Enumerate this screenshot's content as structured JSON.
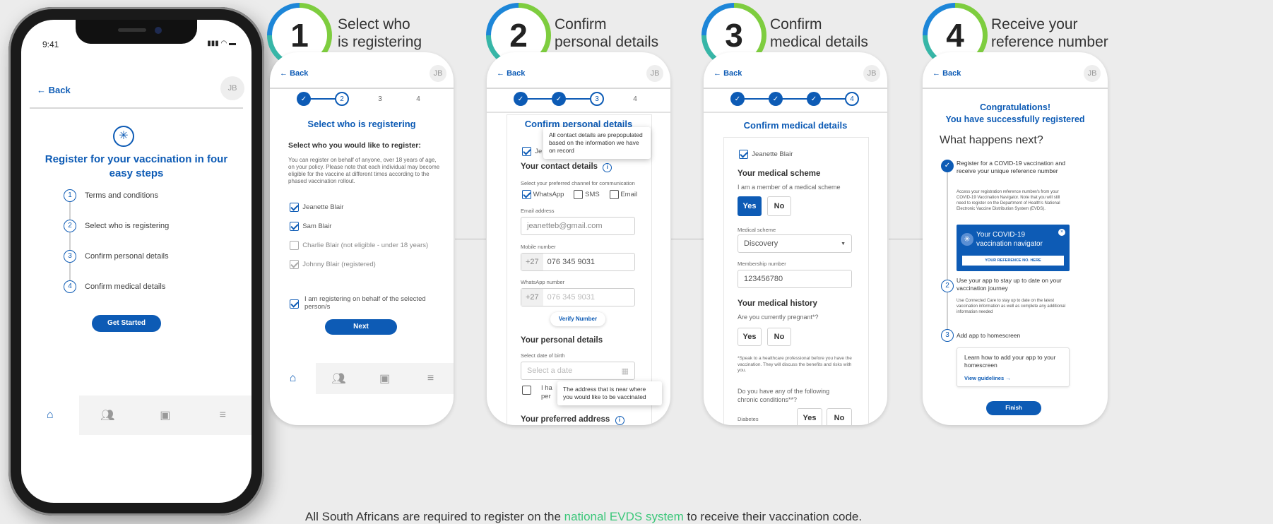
{
  "phone": {
    "time": "9:41",
    "back": "Back",
    "avatar": "JB",
    "title": "Register for your vaccination in four easy steps",
    "steps": [
      {
        "num": "1",
        "label": "Terms and conditions"
      },
      {
        "num": "2",
        "label": "Select who is registering"
      },
      {
        "num": "3",
        "label": "Confirm personal details"
      },
      {
        "num": "4",
        "label": "Confirm medical details"
      }
    ],
    "button": "Get Started"
  },
  "badges": [
    {
      "num": "1",
      "caption": [
        "Select who",
        "is registering"
      ]
    },
    {
      "num": "2",
      "caption": [
        "Confirm",
        "personal details"
      ]
    },
    {
      "num": "3",
      "caption": [
        "Confirm",
        "medical details"
      ]
    },
    {
      "num": "4",
      "caption": [
        "Receive your",
        "reference number"
      ]
    }
  ],
  "common": {
    "back": "Back",
    "avatar": "JB",
    "progress": [
      "1",
      "2",
      "3",
      "4"
    ]
  },
  "card1": {
    "title": "Select who is registering",
    "subtitle": "Select who you would like to register:",
    "intro": "You can register on behalf of anyone, over 18 years of age, on your policy. Please note that each individual may become eligible for the vaccine at different times according to the phased vaccination rollout.",
    "people": [
      "Jeanette Blair",
      "Sam Blair",
      "Charlie Blair (not eligible - under 18 years)",
      "Johnny Blair (registered)"
    ],
    "consent": "I am registering on behalf of the selected person/s",
    "button": "Next"
  },
  "card2": {
    "title": "Confirm personal details",
    "tooltip1": "All contact details are prepopulated based on the information we have on record",
    "name_partial": "Je",
    "contact_heading": "Your contact details",
    "channel_hint": "Select your preferred channel for communication",
    "channels": [
      "WhatsApp",
      "SMS",
      "Email"
    ],
    "email_label": "Email address",
    "email_value": "jeanetteb@gmail.com",
    "mobile_label": "Mobile number",
    "prefix": "+27",
    "mobile_value": "076 345 9031",
    "whatsapp_label": "WhatsApp number",
    "whatsapp_value": "076 345 9031",
    "verify": "Verify Number",
    "personal_heading": "Your personal details",
    "dob_label": "Select date of birth",
    "dob_placeholder": "Select a date",
    "partial_text1": "I ha",
    "partial_text2": "per",
    "tooltip2": "The address that is near where you would like to be vaccinated",
    "address_heading": "Your preferred address"
  },
  "card3": {
    "title": "Confirm medical details",
    "name": "Jeanette Blair",
    "scheme_heading": "Your medical scheme",
    "scheme_q": "I am a member of a medical scheme",
    "yes": "Yes",
    "no": "No",
    "scheme_label": "Medical scheme",
    "scheme_value": "Discovery",
    "membership_label": "Membership number",
    "membership_value": "123456780",
    "history_heading": "Your medical history",
    "pregnant_q": "Are you currently pregnant*?",
    "footnote": "*Speak to a healthcare professional before you have the vaccination. They will discuss the benefits and risks with you.",
    "chronic_q": "Do you have any of the following chronic conditions**?",
    "diabetes": "Diabetes"
  },
  "card4": {
    "congrats1": "Congratulations!",
    "congrats2": "You have successfully registered",
    "next": "What happens next?",
    "s1_title": "Register for a COVID-19 vaccination and receive your unique reference number",
    "s1_text": "Access your registration reference number/s from your COVID-19 Vaccination Navigator. Note that you will still need to register on the Department of Health's National Electronic Vaccine Distribution System (EVDS).",
    "nav_title": "Your COVID-19 vaccination navigator",
    "nav_ref": "YOUR REFERENCE NO. HERE",
    "s2_num": "2",
    "s2_title": "Use your app to stay up to date on your vaccination journey",
    "s2_text": "Use Connected Care to stay up to date on the latest vaccination information as well as complete any additional information needed",
    "s3_num": "3",
    "s3_title": "Add app to homescreen",
    "learn": "Learn how to add your app to your homescreen",
    "guidelines": "View guidelines",
    "button": "Finish"
  },
  "footer": {
    "pre": "All South Africans are required to register on the ",
    "link": "national EVDS system",
    "post": " to receive their vaccination code.",
    "link_color": "#3cc77a"
  }
}
